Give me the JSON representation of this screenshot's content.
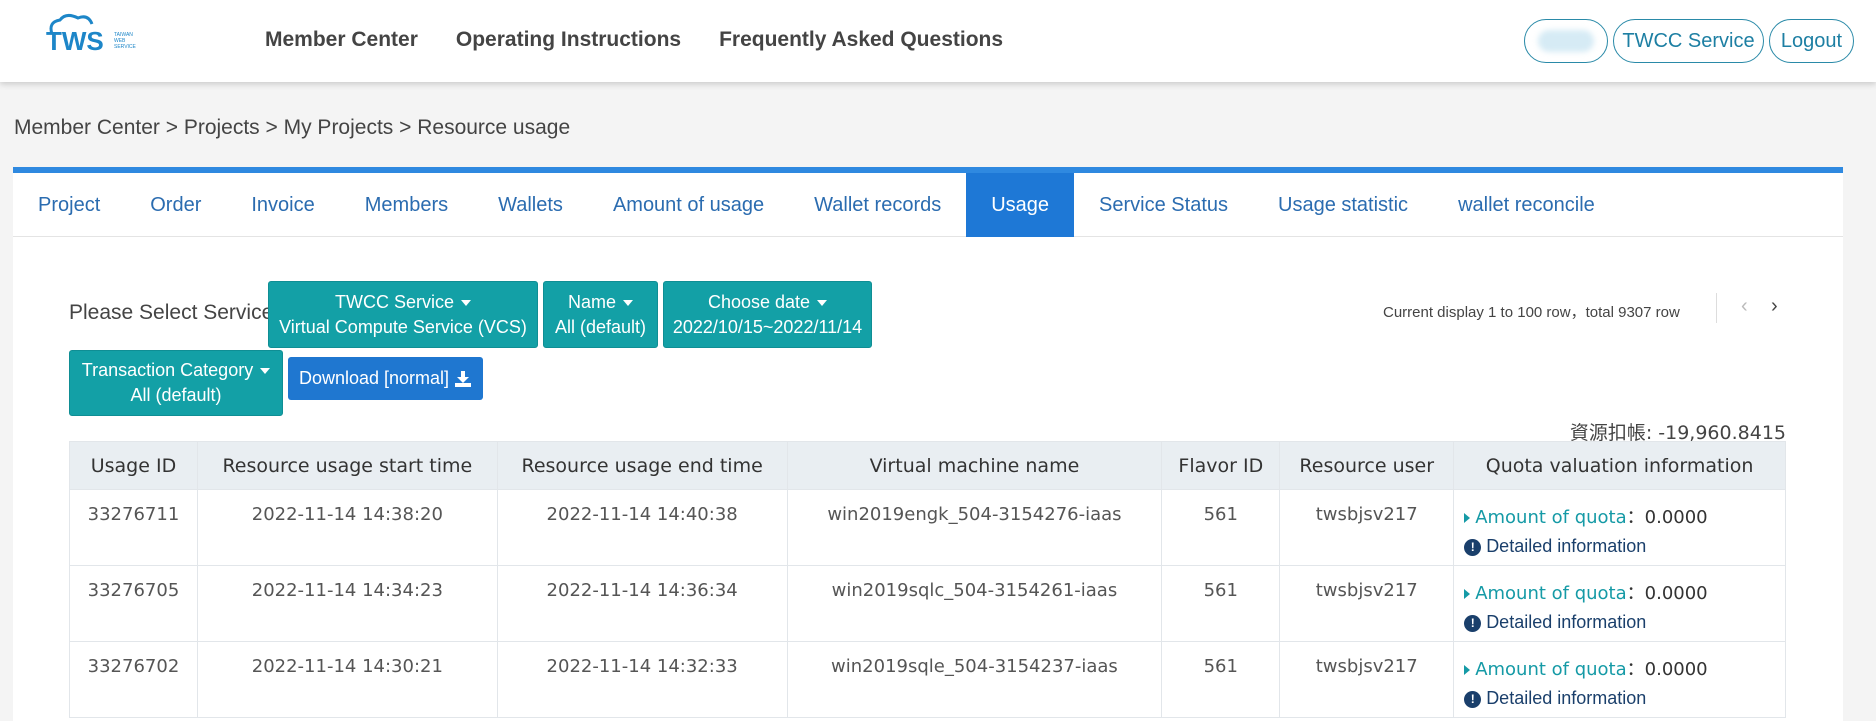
{
  "header": {
    "logo_text": "TWS",
    "logo_sub": "TAIWAN WEB SERVICE",
    "nav": [
      "Member Center",
      "Operating Instructions",
      "Frequently Asked Questions"
    ],
    "service_button": "TWCC Service",
    "logout_button": "Logout"
  },
  "breadcrumb": "Member Center > Projects > My Projects > Resource usage",
  "tabs": [
    "Project",
    "Order",
    "Invoice",
    "Members",
    "Wallets",
    "Amount of usage",
    "Wallet records",
    "Usage",
    "Service Status",
    "Usage statistic",
    "wallet reconcile"
  ],
  "active_tab": "Usage",
  "filters": {
    "label": "Please Select Service",
    "service": {
      "title": "TWCC Service",
      "value": "Virtual Compute Service (VCS)"
    },
    "name": {
      "title": "Name",
      "value": "All (default)"
    },
    "date": {
      "title": "Choose date",
      "value": "2022/10/15~2022/11/14"
    },
    "category": {
      "title": "Transaction Category",
      "value": "All (default)"
    },
    "download": "Download [normal]"
  },
  "pagination": {
    "info": "Current display 1 to 100 row，total 9307 row"
  },
  "deduction": "資源扣帳: -19,960.8415",
  "table": {
    "headers": [
      "Usage ID",
      "Resource usage start time",
      "Resource usage end time",
      "Virtual machine name",
      "Flavor ID",
      "Resource user",
      "Quota valuation information"
    ],
    "rows": [
      {
        "id": "33276711",
        "start": "2022-11-14 14:38:20",
        "end": "2022-11-14 14:40:38",
        "vm": "win2019engk_504-3154276-iaas",
        "flavor": "561",
        "user": "twsbjsv217",
        "quota_label": "Amount of quota",
        "quota_value": "：0.0000",
        "detail": "Detailed information"
      },
      {
        "id": "33276705",
        "start": "2022-11-14 14:34:23",
        "end": "2022-11-14 14:36:34",
        "vm": "win2019sqlc_504-3154261-iaas",
        "flavor": "561",
        "user": "twsbjsv217",
        "quota_label": "Amount of quota",
        "quota_value": "：0.0000",
        "detail": "Detailed information"
      },
      {
        "id": "33276702",
        "start": "2022-11-14 14:30:21",
        "end": "2022-11-14 14:32:33",
        "vm": "win2019sqle_504-3154237-iaas",
        "flavor": "561",
        "user": "twsbjsv217",
        "quota_label": "Amount of quota",
        "quota_value": "：0.0000",
        "detail": "Detailed information"
      }
    ]
  }
}
